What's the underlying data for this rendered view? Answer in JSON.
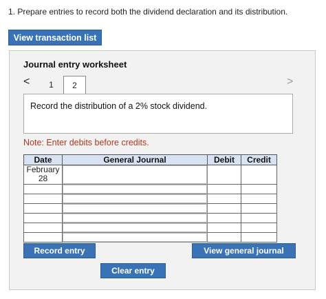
{
  "question": {
    "text": "1. Prepare entries to record both the dividend declaration and its distribution."
  },
  "view_transaction_list": {
    "label": "View transaction list"
  },
  "worksheet": {
    "title": "Journal entry worksheet",
    "nav_prev": "<",
    "nav_next": ">",
    "tabs": [
      {
        "label": "1"
      },
      {
        "label": "2"
      }
    ],
    "active_tab": "2",
    "instruction": "Record the distribution of a 2% stock dividend.",
    "note": "Note: Enter debits before credits.",
    "table": {
      "headers": {
        "date": "Date",
        "account": "General Journal",
        "debit": "Debit",
        "credit": "Credit"
      },
      "first_row_date": {
        "month": "February",
        "day": "28"
      }
    },
    "buttons": {
      "record_entry": "Record entry",
      "view_general_journal": "View general journal",
      "clear_entry": "Clear entry"
    }
  },
  "colors": {
    "button_blue": "#3a73b5",
    "header_blue": "#d7e3f2",
    "note_red": "#b3361f"
  }
}
